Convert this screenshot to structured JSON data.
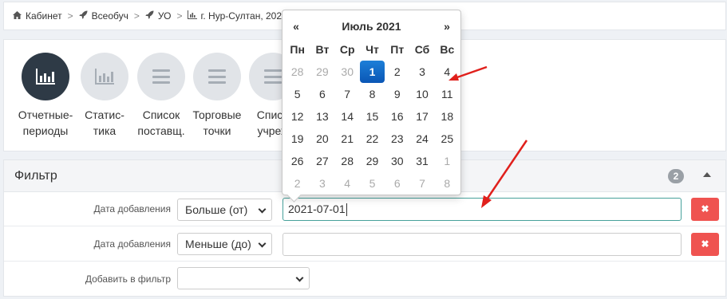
{
  "breadcrumb": {
    "items": [
      {
        "label": "Кабинет",
        "icon": "home-icon"
      },
      {
        "label": "Всеобуч",
        "icon": "rocket-icon"
      },
      {
        "label": "УО",
        "icon": "rocket-icon"
      },
      {
        "label": "г. Нур-Султан, 202",
        "icon": "bar-chart-icon"
      }
    ],
    "separator": ">"
  },
  "tiles": [
    {
      "line1": "Отчетные-",
      "line2": "периоды",
      "active": true,
      "icon": "bar-chart-icon"
    },
    {
      "line1": "Статис-",
      "line2": "тика",
      "active": false,
      "icon": "bar-chart-icon"
    },
    {
      "line1": "Список",
      "line2": "поставщ.",
      "active": false,
      "icon": "list-icon"
    },
    {
      "line1": "Торговые",
      "line2": "точки",
      "active": false,
      "icon": "list-icon"
    },
    {
      "line1": "Списо",
      "line2": "учреж",
      "active": false,
      "icon": "list-icon"
    }
  ],
  "filter": {
    "title": "Фильтр",
    "count": "2",
    "rows": [
      {
        "label": "Дата добавления",
        "operator": "Больше (от)",
        "value": "2021-07-01",
        "delete": "✖"
      },
      {
        "label": "Дата добавления",
        "operator": "Меньше (до)",
        "value": "",
        "delete": "✖"
      }
    ],
    "add_label": "Добавить в фильтр",
    "add_value": ""
  },
  "datepicker": {
    "prev": "«",
    "next": "»",
    "title": "Июль 2021",
    "weekdays": [
      "Пн",
      "Вт",
      "Ср",
      "Чт",
      "Пт",
      "Сб",
      "Вс"
    ],
    "weeks": [
      [
        [
          "28",
          "other"
        ],
        [
          "29",
          "other"
        ],
        [
          "30",
          "other"
        ],
        [
          "1",
          "selected"
        ],
        [
          "2",
          ""
        ],
        [
          "3",
          ""
        ],
        [
          "4",
          ""
        ]
      ],
      [
        [
          "5",
          ""
        ],
        [
          "6",
          ""
        ],
        [
          "7",
          ""
        ],
        [
          "8",
          ""
        ],
        [
          "9",
          ""
        ],
        [
          "10",
          ""
        ],
        [
          "11",
          ""
        ]
      ],
      [
        [
          "12",
          ""
        ],
        [
          "13",
          ""
        ],
        [
          "14",
          ""
        ],
        [
          "15",
          ""
        ],
        [
          "16",
          ""
        ],
        [
          "17",
          ""
        ],
        [
          "18",
          ""
        ]
      ],
      [
        [
          "19",
          ""
        ],
        [
          "20",
          ""
        ],
        [
          "21",
          ""
        ],
        [
          "22",
          ""
        ],
        [
          "23",
          ""
        ],
        [
          "24",
          ""
        ],
        [
          "25",
          ""
        ]
      ],
      [
        [
          "26",
          ""
        ],
        [
          "27",
          ""
        ],
        [
          "28",
          ""
        ],
        [
          "29",
          ""
        ],
        [
          "30",
          ""
        ],
        [
          "31",
          ""
        ],
        [
          "1",
          "other"
        ]
      ],
      [
        [
          "2",
          "other"
        ],
        [
          "3",
          "other"
        ],
        [
          "4",
          "other"
        ],
        [
          "5",
          "other"
        ],
        [
          "6",
          "other"
        ],
        [
          "7",
          "other"
        ],
        [
          "8",
          "other"
        ]
      ]
    ]
  },
  "colors": {
    "accent_dark": "#2e3a46",
    "selected_day": "#0a56b5",
    "delete_button": "#ef5350",
    "annotation_arrow": "#e0201c"
  }
}
